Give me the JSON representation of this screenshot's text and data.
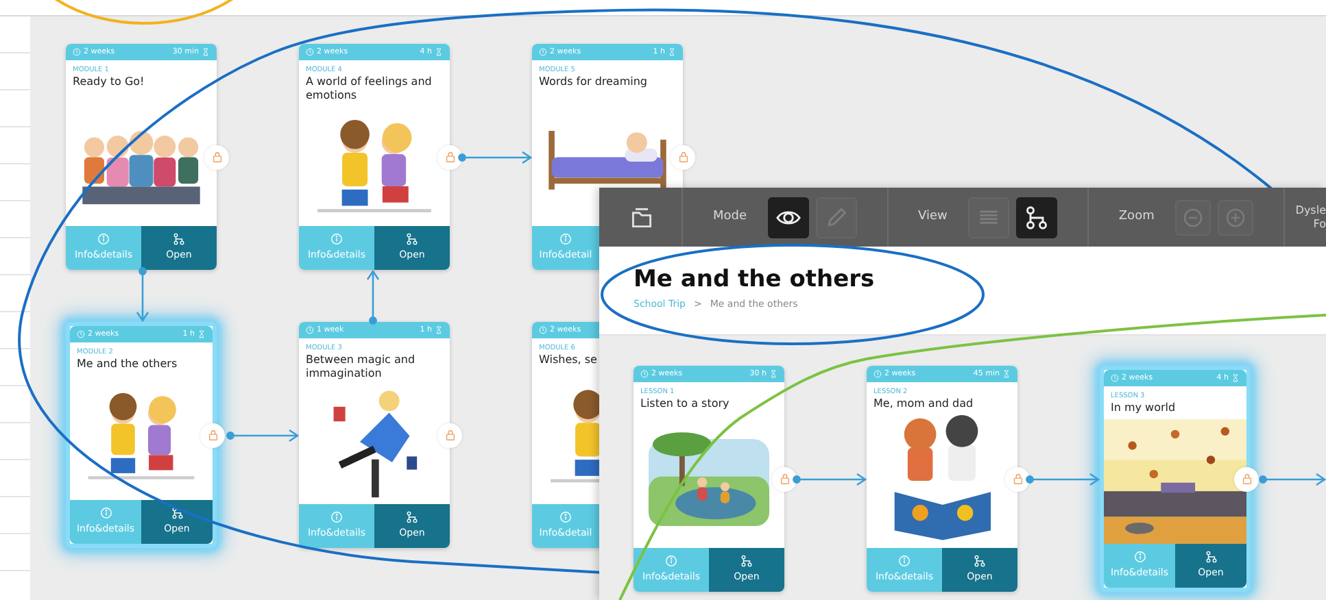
{
  "back_screen": {
    "modules": [
      {
        "label": "MODULE 1",
        "title": "Ready to Go!",
        "duration": "2 weeks",
        "time": "30 min",
        "selected": false,
        "locked": true,
        "buttons": [
          {
            "kind": "info",
            "label": "Info&details"
          },
          {
            "kind": "open",
            "label": "Open"
          }
        ]
      },
      {
        "label": "MODULE 4",
        "title": "A world of feelings and emotions",
        "duration": "2 weeks",
        "time": "4 h",
        "selected": false,
        "locked": true,
        "buttons": [
          {
            "kind": "info",
            "label": "Info&details"
          },
          {
            "kind": "open",
            "label": "Open"
          }
        ]
      },
      {
        "label": "MODULE 5",
        "title": "Words for dreaming",
        "duration": "2 weeks",
        "time": "1 h",
        "selected": false,
        "locked": true,
        "buttons": [
          {
            "kind": "info",
            "label": "Info&detail"
          }
        ]
      },
      {
        "label": "MODULE 2",
        "title": "Me and the others",
        "duration": "2 weeks",
        "time": "1 h",
        "selected": true,
        "locked": true,
        "buttons": [
          {
            "kind": "info",
            "label": "Info&details"
          },
          {
            "kind": "open",
            "label": "Open"
          }
        ]
      },
      {
        "label": "MODULE 3",
        "title": "Between magic and immagination",
        "duration": "1 week",
        "time": "1 h",
        "selected": false,
        "locked": true,
        "buttons": [
          {
            "kind": "info",
            "label": "Info&details"
          },
          {
            "kind": "open",
            "label": "Open"
          }
        ]
      },
      {
        "label": "MODULE 6",
        "title": "Wishes, se",
        "duration": "2 weeks",
        "selected": false,
        "buttons": [
          {
            "kind": "info",
            "label": "Info&detail"
          }
        ]
      }
    ]
  },
  "front_screen": {
    "toolbar": {
      "groups": [
        {
          "kind": "folder"
        },
        {
          "kind": "mode",
          "label": "Mode",
          "options": [
            {
              "kind": "eye",
              "selected": true
            },
            {
              "kind": "pencil",
              "selected": false
            }
          ]
        },
        {
          "kind": "view",
          "label": "View",
          "options": [
            {
              "kind": "list",
              "selected": false
            },
            {
              "kind": "tree",
              "selected": true
            }
          ]
        },
        {
          "kind": "zoom",
          "label": "Zoom",
          "options": [
            {
              "kind": "minus"
            },
            {
              "kind": "plus"
            }
          ]
        },
        {
          "kind": "text",
          "lines": [
            "Dysle",
            "Fo"
          ]
        }
      ]
    },
    "title": "Me and the others",
    "breadcrumb": [
      {
        "label": "School Trip",
        "kind": "link"
      },
      {
        "label": ">",
        "kind": "separator"
      },
      {
        "label": "Me and the others",
        "kind": "current"
      }
    ],
    "lessons": [
      {
        "label": "LESSON 1",
        "title": "Listen to a story",
        "duration": "2 weeks",
        "time": "30 h",
        "selected": false,
        "locked": true,
        "buttons": [
          {
            "kind": "info",
            "label": "Info&details"
          },
          {
            "kind": "open",
            "label": "Open"
          }
        ]
      },
      {
        "label": "LESSON 2",
        "title": "Me, mom and dad",
        "duration": "2 weeks",
        "time": "45 min",
        "selected": false,
        "locked": true,
        "buttons": [
          {
            "kind": "info",
            "label": "Info&details"
          },
          {
            "kind": "open",
            "label": "Open"
          }
        ]
      },
      {
        "label": "LESSON 3",
        "title": "In my world",
        "duration": "2 weeks",
        "time": "4 h",
        "selected": true,
        "locked": true,
        "buttons": [
          {
            "kind": "info",
            "label": "Info&details"
          },
          {
            "kind": "open",
            "label": "Open"
          }
        ]
      }
    ]
  }
}
